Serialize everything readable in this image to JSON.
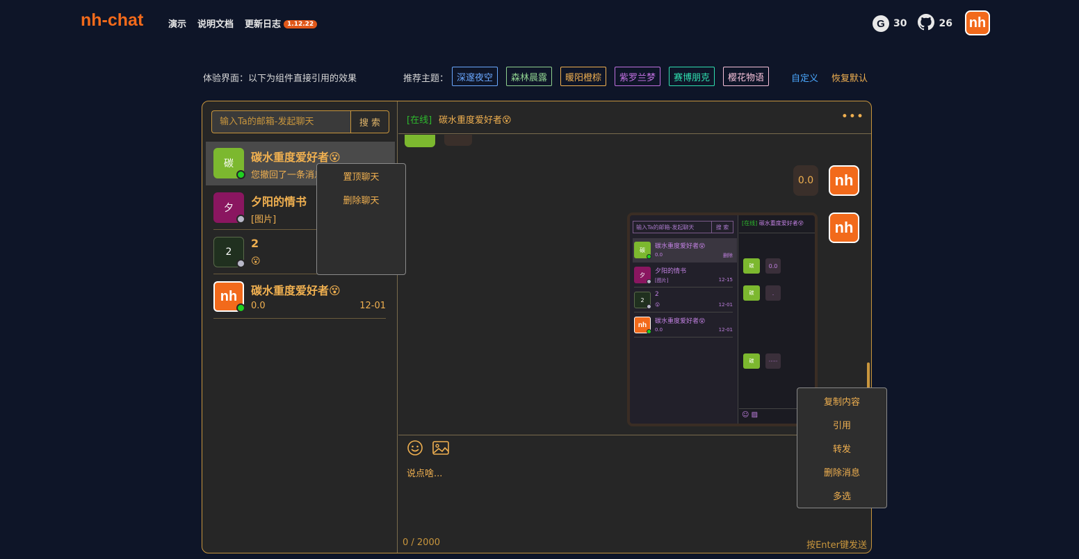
{
  "header": {
    "brand": "nh-chat",
    "nav": [
      "演示",
      "说明文档",
      "更新日志"
    ],
    "version_badge": "1.12.22",
    "stats": [
      {
        "icon": "gitee-icon",
        "value": "30"
      },
      {
        "icon": "github-icon",
        "value": "26"
      }
    ],
    "avatar_text": "nh"
  },
  "themes": {
    "experience_label": "体验界面：以下为组件直接引用的效果",
    "recommend_label": "推荐主题：",
    "items": [
      {
        "label": "深邃夜空",
        "color": "#6aa8ff"
      },
      {
        "label": "森林晨露",
        "color": "#8fd18f"
      },
      {
        "label": "暖阳橙棕",
        "color": "#f0b050"
      },
      {
        "label": "紫罗兰梦",
        "color": "#c070e0"
      },
      {
        "label": "赛博朋克",
        "color": "#30e0b0"
      },
      {
        "label": "樱花物语",
        "color": "#f5c0d8"
      }
    ],
    "custom_label": "自定义",
    "reset_label": "恢复默认"
  },
  "sidebar": {
    "search_placeholder": "输入Ta的邮箱-发起聊天",
    "search_button": "搜 索",
    "conversations": [
      {
        "avatar_text": "碳",
        "avatar_color": "#7cb82f",
        "name": "碳水重度爱好者😵",
        "preview": "您撤回了一条消息",
        "time": "",
        "online": true
      },
      {
        "avatar_text": "夕",
        "avatar_color": "#8a1660",
        "name": "夕阳的情书",
        "preview": "[图片]",
        "time": "",
        "online": false
      },
      {
        "avatar_text": "2",
        "avatar_color": "#20301f",
        "name": "2",
        "preview": "😮",
        "time": "",
        "online": false
      },
      {
        "avatar_text": "nh",
        "avatar_color": "#f26a1b",
        "name": "碳水重度爱好者😵",
        "preview": "0.0",
        "time": "12-01",
        "online": true
      }
    ],
    "context_menu": [
      "置顶聊天",
      "删除聊天"
    ]
  },
  "chat": {
    "status": "[在线]",
    "title": "碳水重度爱好者😵",
    "more": "•••",
    "messages": [
      {
        "type": "text",
        "from": "self",
        "text": "0.0"
      },
      {
        "type": "image",
        "from": "self"
      }
    ],
    "message_menu": [
      "复制内容",
      "引用",
      "转发",
      "删除消息",
      "多选"
    ],
    "input_placeholder": "说点啥...",
    "counter": "0 / 2000",
    "send_hint": "按Enter键发送"
  },
  "screenshot_preview": {
    "search_placeholder": "输入Ta的邮箱-发起聊天",
    "search_button": "搜 索",
    "header_status": "[在线]",
    "header_title": "碳水重度爱好者😵",
    "conversations": [
      {
        "avatar_text": "碳",
        "avatar_color": "#7cb82f",
        "name": "碳水重度爱好者😵",
        "preview": "0.0",
        "time": "删除",
        "online": true
      },
      {
        "avatar_text": "夕",
        "avatar_color": "#8a1660",
        "name": "夕阳的情书",
        "preview": "[图片]",
        "time": "12-15",
        "online": false
      },
      {
        "avatar_text": "2",
        "avatar_color": "#20301f",
        "name": "2",
        "preview": "😮",
        "time": "12-01",
        "online": false
      },
      {
        "avatar_text": "nh",
        "avatar_color": "#f26a1b",
        "name": "碳水重度爱好者😵",
        "preview": "0.0",
        "time": "12-01",
        "online": true
      }
    ],
    "messages": [
      {
        "avatar_text": "碳",
        "text": "0.0"
      },
      {
        "avatar_text": "碳",
        "text": "."
      },
      {
        "avatar_text": "碳",
        "text": "·····"
      }
    ]
  }
}
